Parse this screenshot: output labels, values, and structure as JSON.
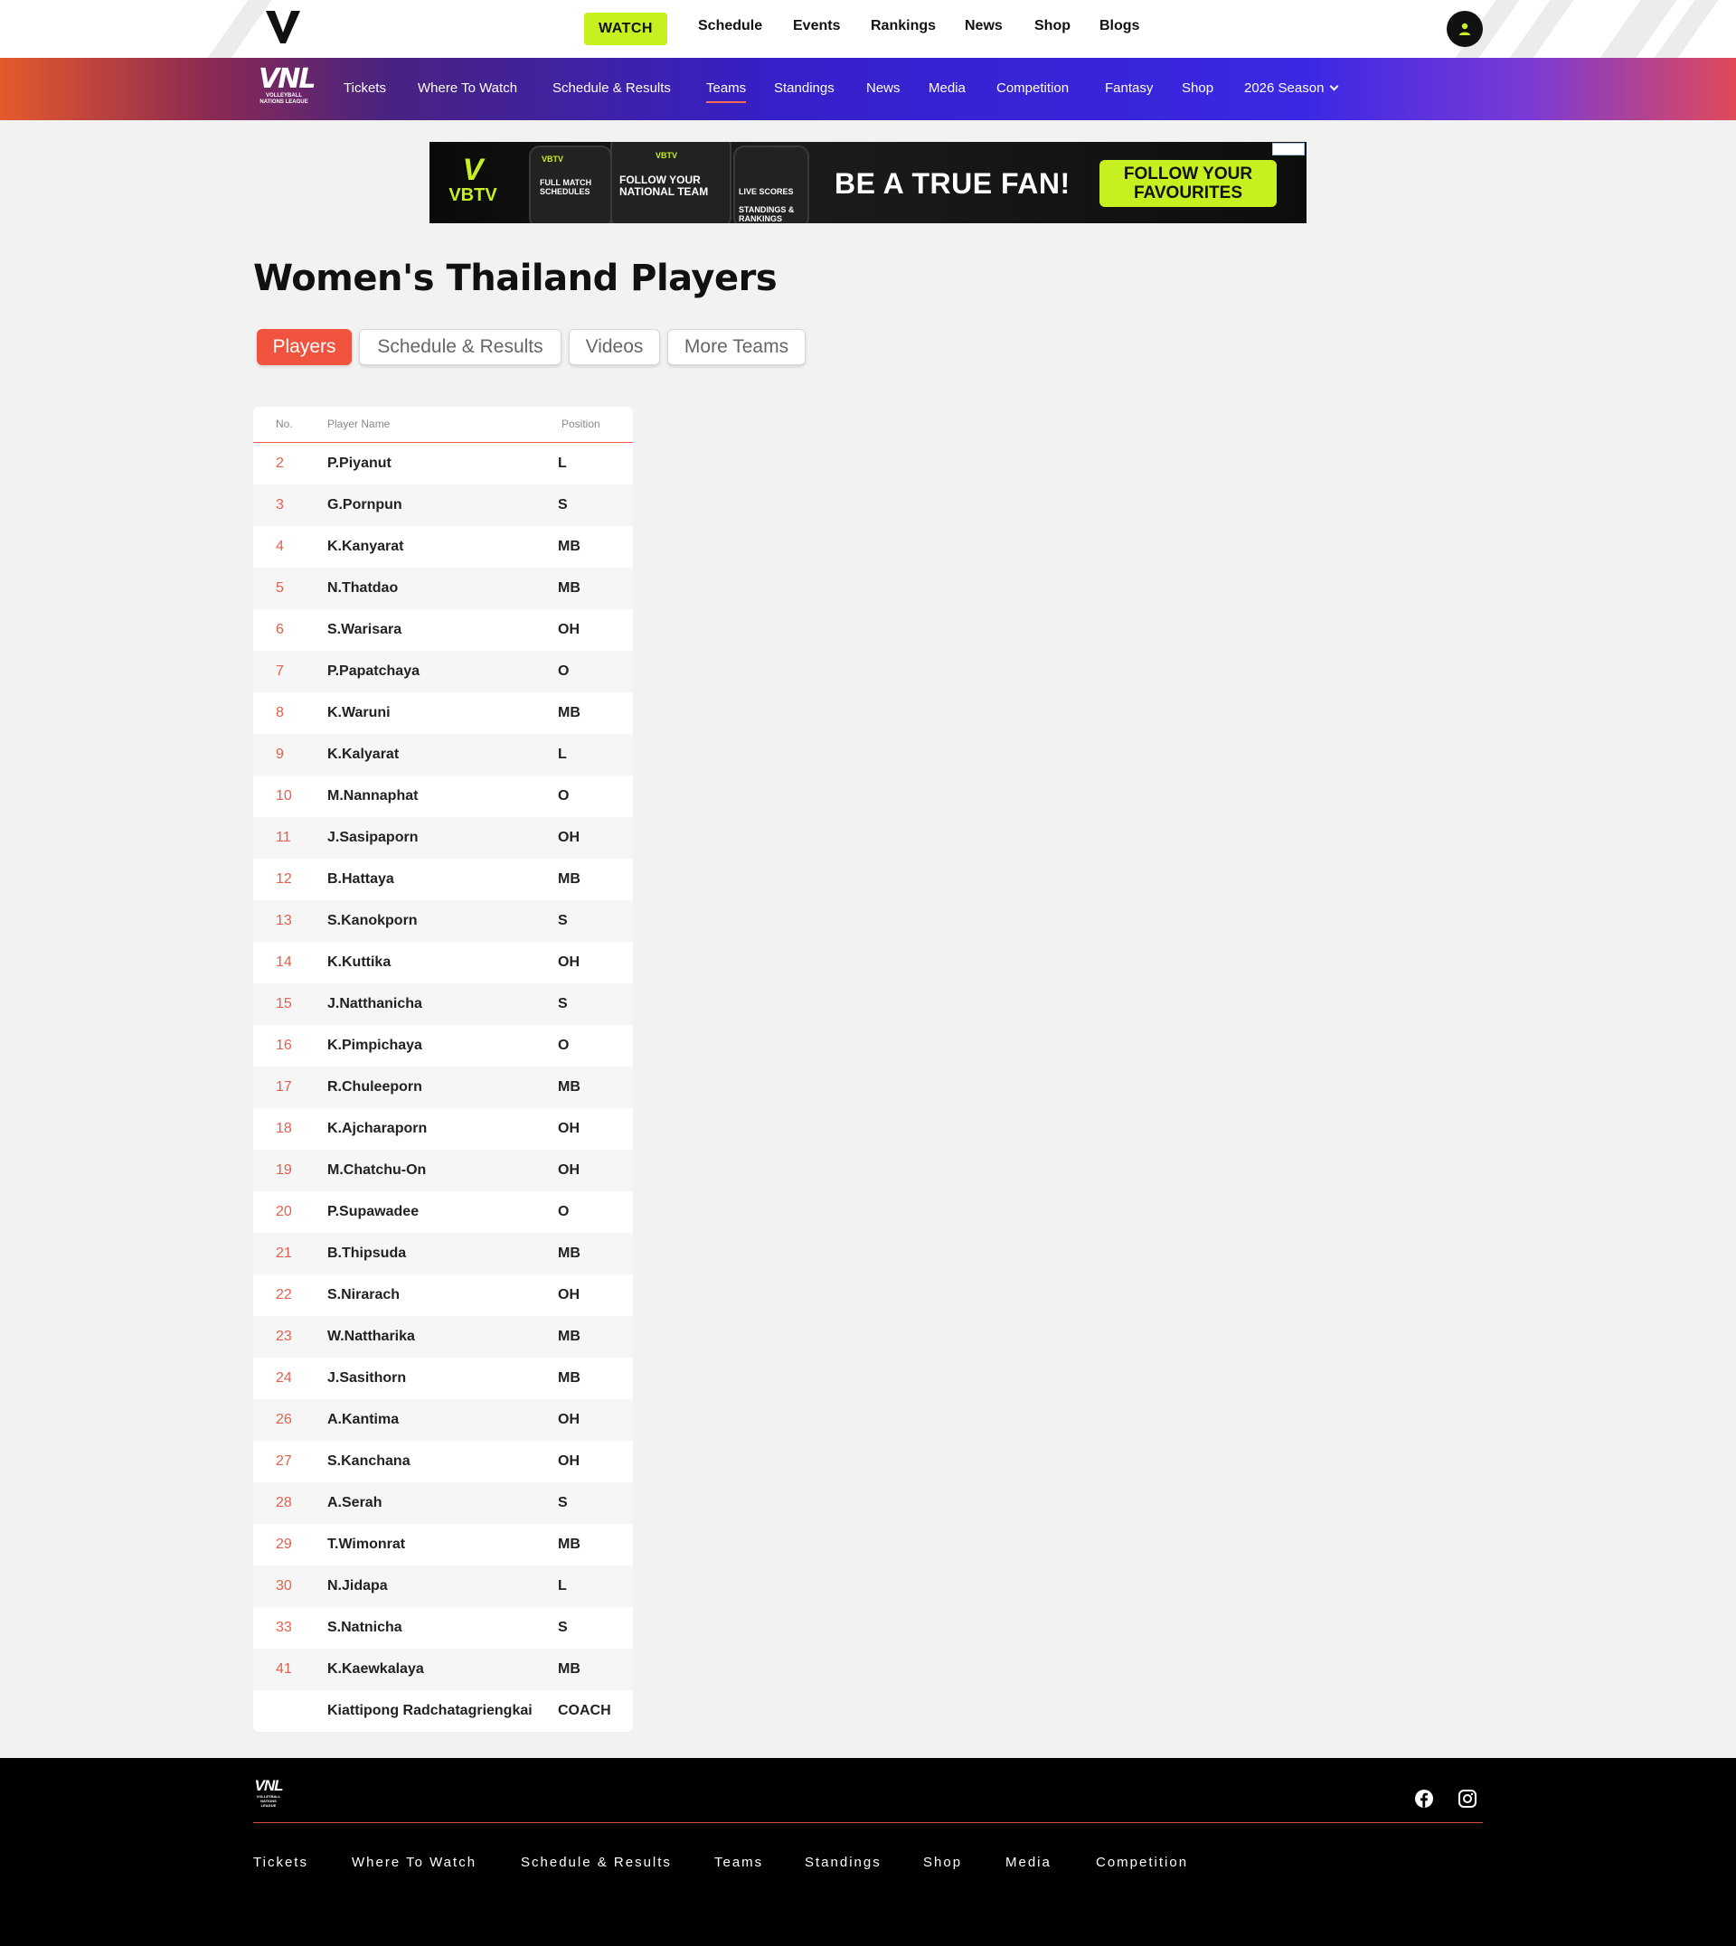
{
  "topbar": {
    "logo": "volleyball-world-logo",
    "watch_label": "WATCH",
    "nav": [
      "Schedule",
      "Events",
      "Rankings",
      "News",
      "Shop",
      "Blogs"
    ],
    "user_icon": "user-icon",
    "accent_color": "#c6f01f"
  },
  "vnl_nav": {
    "logo_text": "VNL",
    "logo_sub": "VOLLEYBALL NATIONS LEAGUE",
    "items": [
      "Tickets",
      "Where To Watch",
      "Schedule & Results",
      "Teams",
      "Standings",
      "News",
      "Media",
      "Competition",
      "Fantasy",
      "Shop"
    ],
    "active": "Teams",
    "season_label": "2026 Season"
  },
  "ad": {
    "brand_v": "V",
    "brand": "VBTV",
    "phone1_header": "VBTV",
    "phone1": "FULL MATCH SCHEDULES",
    "phone2_header": "VBTV",
    "phone2": "FOLLOW YOUR NATIONAL TEAM",
    "phone3": "LIVE SCORES",
    "phone3b": "STANDINGS & RANKINGS",
    "headline": "BE A TRUE FAN!",
    "cta": "FOLLOW YOUR FAVOURITES"
  },
  "page": {
    "title": "Women's Thailand Players",
    "tabs": [
      "Players",
      "Schedule & Results",
      "Videos",
      "More Teams"
    ],
    "active_tab": "Players",
    "accent_color": "#f0533e"
  },
  "table": {
    "headers": {
      "no": "No.",
      "name": "Player Name",
      "position": "Position"
    },
    "rows": [
      {
        "no": "2",
        "name": "P.Piyanut",
        "position": "L"
      },
      {
        "no": "3",
        "name": "G.Pornpun",
        "position": "S"
      },
      {
        "no": "4",
        "name": "K.Kanyarat",
        "position": "MB"
      },
      {
        "no": "5",
        "name": "N.Thatdao",
        "position": "MB"
      },
      {
        "no": "6",
        "name": "S.Warisara",
        "position": "OH"
      },
      {
        "no": "7",
        "name": "P.Papatchaya",
        "position": "O"
      },
      {
        "no": "8",
        "name": "K.Waruni",
        "position": "MB"
      },
      {
        "no": "9",
        "name": "K.Kalyarat",
        "position": "L"
      },
      {
        "no": "10",
        "name": "M.Nannaphat",
        "position": "O"
      },
      {
        "no": "11",
        "name": "J.Sasipaporn",
        "position": "OH"
      },
      {
        "no": "12",
        "name": "B.Hattaya",
        "position": "MB"
      },
      {
        "no": "13",
        "name": "S.Kanokporn",
        "position": "S"
      },
      {
        "no": "14",
        "name": "K.Kuttika",
        "position": "OH"
      },
      {
        "no": "15",
        "name": "J.Natthanicha",
        "position": "S"
      },
      {
        "no": "16",
        "name": "K.Pimpichaya",
        "position": "O"
      },
      {
        "no": "17",
        "name": "R.Chuleeporn",
        "position": "MB"
      },
      {
        "no": "18",
        "name": "K.Ajcharaporn",
        "position": "OH"
      },
      {
        "no": "19",
        "name": "M.Chatchu-On",
        "position": "OH"
      },
      {
        "no": "20",
        "name": "P.Supawadee",
        "position": "O"
      },
      {
        "no": "21",
        "name": "B.Thipsuda",
        "position": "MB"
      },
      {
        "no": "22",
        "name": "S.Nirarach",
        "position": "OH"
      },
      {
        "no": "23",
        "name": "W.Nattharika",
        "position": "MB"
      },
      {
        "no": "24",
        "name": "J.Sasithorn",
        "position": "MB"
      },
      {
        "no": "26",
        "name": "A.Kantima",
        "position": "OH"
      },
      {
        "no": "27",
        "name": "S.Kanchana",
        "position": "OH"
      },
      {
        "no": "28",
        "name": "A.Serah",
        "position": "S"
      },
      {
        "no": "29",
        "name": "T.Wimonrat",
        "position": "MB"
      },
      {
        "no": "30",
        "name": "N.Jidapa",
        "position": "L"
      },
      {
        "no": "33",
        "name": "S.Natnicha",
        "position": "S"
      },
      {
        "no": "41",
        "name": "K.Kaewkalaya",
        "position": "MB"
      },
      {
        "no": "",
        "name": "Kiattipong Radchatagriengkai",
        "position": "COACH"
      }
    ]
  },
  "footer": {
    "logo_text": "VNL",
    "social": [
      "facebook-icon",
      "instagram-icon"
    ],
    "links": [
      "Tickets",
      "Where To Watch",
      "Schedule & Results",
      "Teams",
      "Standings",
      "Shop",
      "Media",
      "Competition"
    ]
  }
}
